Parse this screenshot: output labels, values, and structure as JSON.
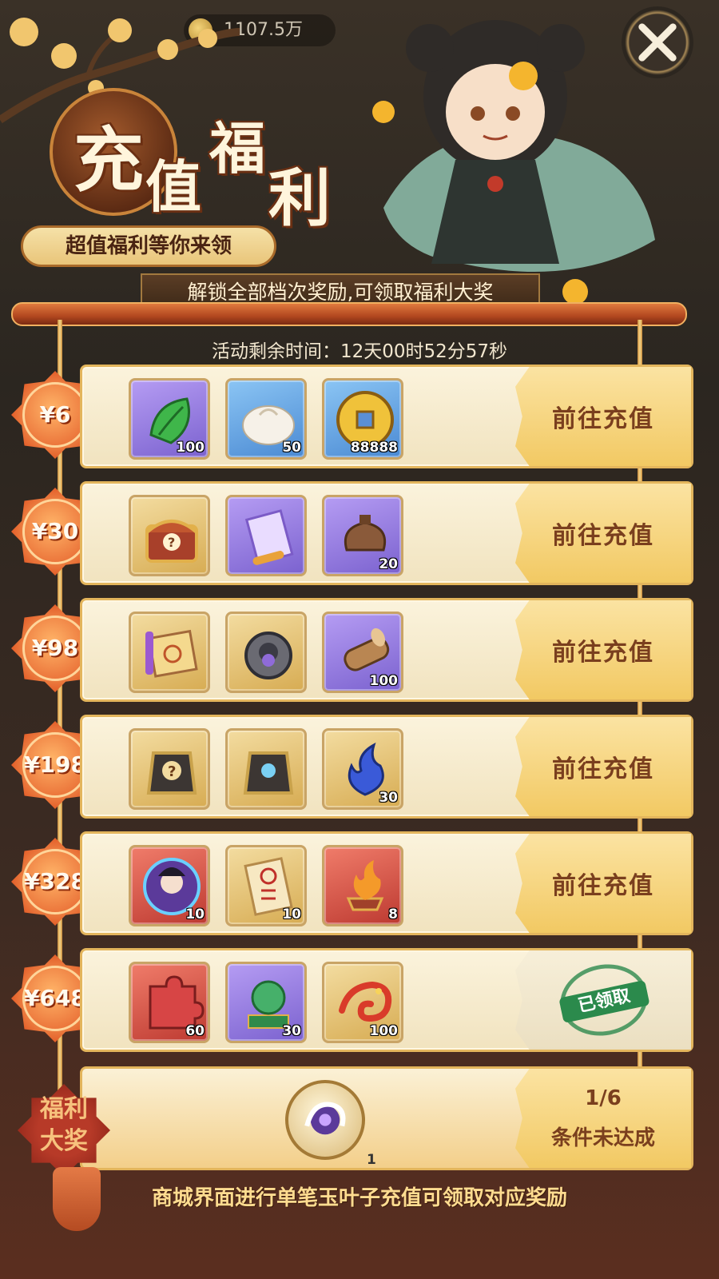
{
  "top_bar": {
    "resource_2": "1107.5万"
  },
  "title": {
    "chars": [
      "充",
      "值",
      "福",
      "利"
    ],
    "subtitle": "超值福利等你来领",
    "banner": "解锁全部档次奖励,可领取福利大奖"
  },
  "timer": {
    "label": "活动剩余时间：",
    "value": "12天00时52分57秒"
  },
  "tiers": [
    {
      "price": "¥6",
      "button": "前往充值",
      "claimed": false,
      "rewards": [
        {
          "icon": "jade-leaf-icon",
          "frame": "purple",
          "qty": "100"
        },
        {
          "icon": "steamed-bun-icon",
          "frame": "blue",
          "qty": "50"
        },
        {
          "icon": "gold-coin-icon",
          "frame": "blue",
          "qty": "88888"
        }
      ]
    },
    {
      "price": "¥30",
      "button": "前往充值",
      "claimed": false,
      "rewards": [
        {
          "icon": "mystery-chest-icon",
          "frame": "gold",
          "qty": ""
        },
        {
          "icon": "scroll-icon",
          "frame": "purple",
          "qty": ""
        },
        {
          "icon": "pouch-icon",
          "frame": "purple",
          "qty": "20"
        }
      ]
    },
    {
      "price": "¥98",
      "button": "前往充值",
      "claimed": false,
      "rewards": [
        {
          "icon": "magic-scroll-icon",
          "frame": "gold",
          "qty": ""
        },
        {
          "icon": "gear-icon",
          "frame": "gold",
          "qty": ""
        },
        {
          "icon": "wood-log-icon",
          "frame": "purple",
          "qty": "100"
        }
      ]
    },
    {
      "price": "¥198",
      "button": "前往充值",
      "claimed": false,
      "rewards": [
        {
          "icon": "mystery-armor-icon",
          "frame": "gold",
          "qty": ""
        },
        {
          "icon": "armor-icon",
          "frame": "gold",
          "qty": ""
        },
        {
          "icon": "blue-flame-icon",
          "frame": "gold",
          "qty": "30"
        }
      ]
    },
    {
      "price": "¥328",
      "button": "前往充值",
      "claimed": false,
      "rewards": [
        {
          "icon": "hero-portrait-icon",
          "frame": "red",
          "qty": "10"
        },
        {
          "icon": "talisman-icon",
          "frame": "gold",
          "qty": "10"
        },
        {
          "icon": "fire-brazier-icon",
          "frame": "red",
          "qty": "8"
        }
      ]
    },
    {
      "price": "¥648",
      "button": "已领取",
      "claimed": true,
      "rewards": [
        {
          "icon": "puzzle-piece-icon",
          "frame": "red",
          "qty": "60"
        },
        {
          "icon": "jade-lion-icon",
          "frame": "purple",
          "qty": "30"
        },
        {
          "icon": "dragon-icon",
          "frame": "gold",
          "qty": "100"
        }
      ]
    }
  ],
  "grand_prize": {
    "badge_line1": "福利",
    "badge_line2": "大奖",
    "reward_icon": "dragon-medal-icon",
    "reward_qty": "1",
    "progress": "1/6",
    "status": "条件未达成"
  },
  "footer": "商城界面进行单笔玉叶子充值可领取对应奖励",
  "colors": {
    "accent": "#f2c963",
    "button_text": "#7a3f1e",
    "claimed_green": "#2b8a4c",
    "badge_orange": "#e35f2a"
  }
}
